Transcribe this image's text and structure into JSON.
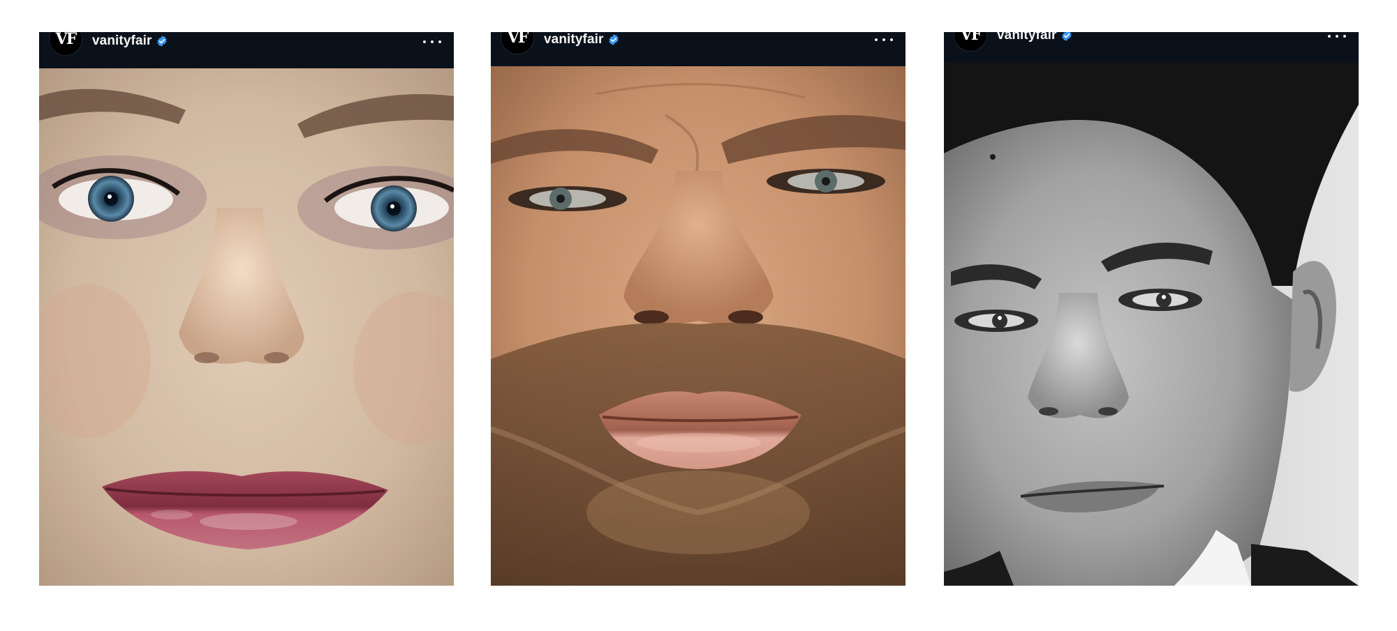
{
  "posts": [
    {
      "username": "vanityfair",
      "avatar_text": "VF",
      "verified": true,
      "more_icon": "more-horizontal-icon",
      "photo": "close-up portrait of a woman with blue eyes and glossy pink lips",
      "tone": "color"
    },
    {
      "username": "vanityfair",
      "avatar_text": "VF",
      "verified": true,
      "more_icon": "more-horizontal-icon",
      "photo": "close-up portrait of a bearded man with furrowed brow",
      "tone": "color-warm"
    },
    {
      "username": "vanityfair",
      "avatar_text": "VF",
      "verified": true,
      "more_icon": "more-horizontal-icon",
      "photo": "black and white close-up portrait of a dark-haired man",
      "tone": "monochrome"
    }
  ],
  "colors": {
    "header_bg": "#0b111b",
    "verified_blue": "#3897f0",
    "page_bg": "#ffffff"
  }
}
